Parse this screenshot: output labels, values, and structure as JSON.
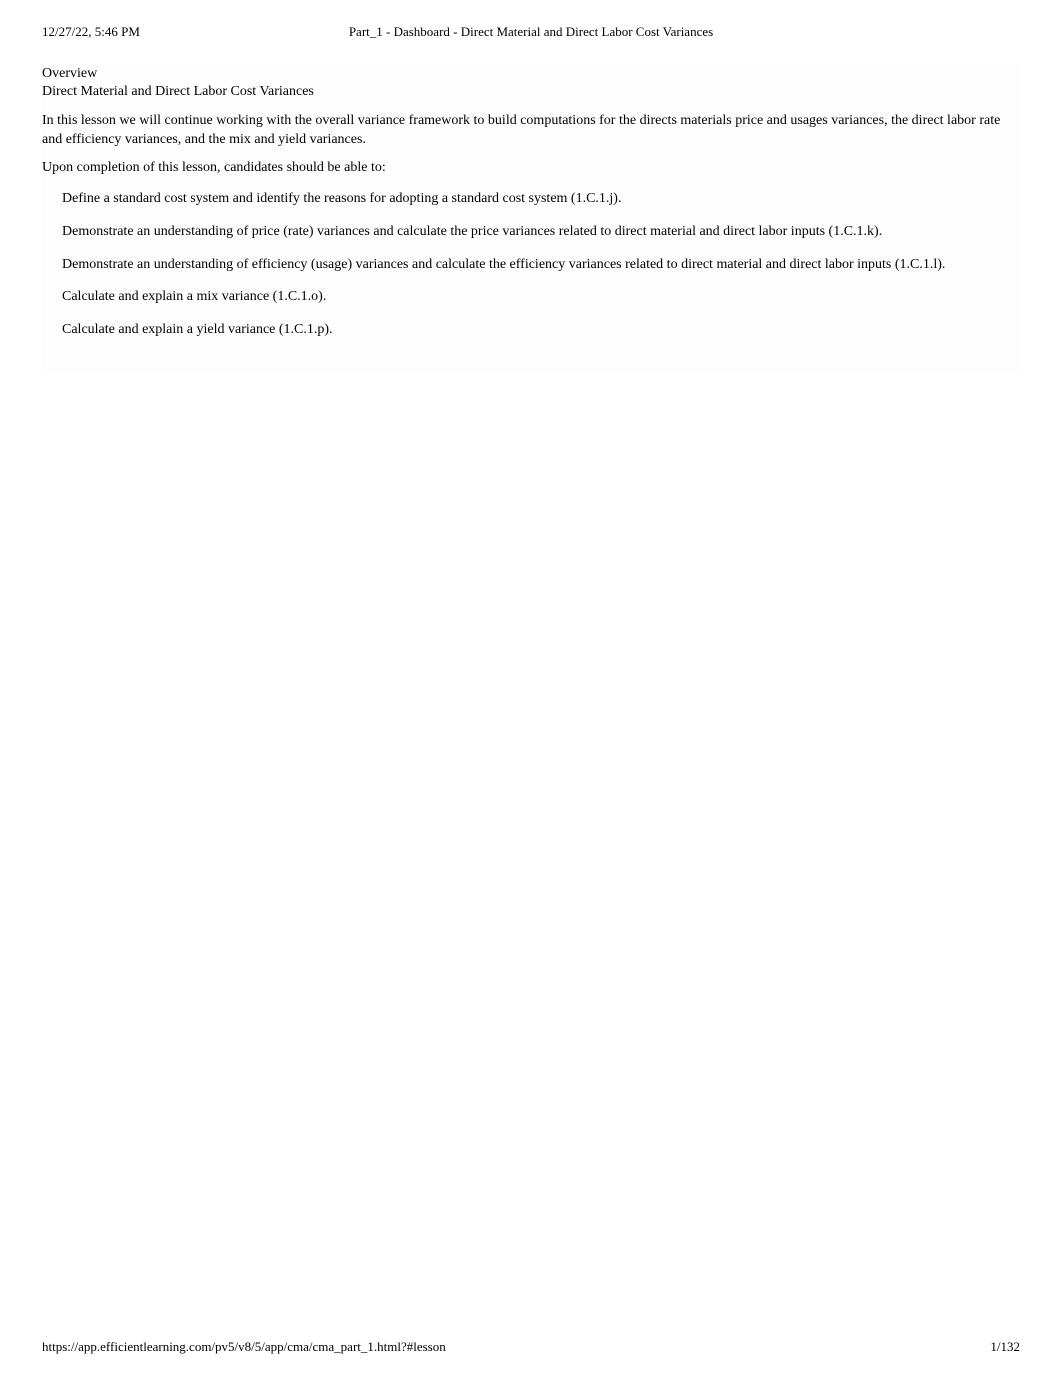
{
  "header": {
    "timestamp": "12/27/22, 5:46 PM",
    "title": "Part_1 - Dashboard - Direct Material and Direct Labor Cost Variances"
  },
  "content": {
    "overview_heading": "Overview",
    "subheading": "Direct Material and Direct Labor Cost Variances",
    "intro_paragraph": "In this lesson we will continue working with the overall variance framework to build computations for the directs materials price and usages variances, the direct labor rate and efficiency variances, and the mix and yield variances.",
    "completion_text": "Upon completion of this lesson, candidates should be able to:",
    "bullets": [
      "Define a standard cost system and identify the reasons for adopting a standard cost system (1.C.1.j).",
      "Demonstrate an understanding of price (rate) variances and calculate the price variances related to direct material and direct labor inputs (1.C.1.k).",
      "Demonstrate an understanding of efficiency (usage) variances and calculate the efficiency variances related to direct material and direct labor inputs (1.C.1.l).",
      "Calculate and explain a mix variance (1.C.1.o).",
      "Calculate and explain a yield variance (1.C.1.p)."
    ]
  },
  "footer": {
    "url": "https://app.efficientlearning.com/pv5/v8/5/app/cma/cma_part_1.html?#lesson",
    "page_number": "1/132"
  }
}
